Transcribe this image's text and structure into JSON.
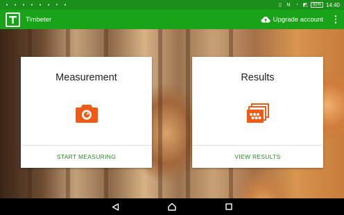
{
  "status_bar": {
    "time": "14:40",
    "battery": "92%",
    "left_icons": [
      "notification-icon",
      "notification-icon",
      "notification-icon",
      "notification-icon",
      "notification-icon",
      "notification-icon",
      "notification-icon",
      "notification-icon"
    ],
    "right_icons": [
      "vibrate-icon",
      "nfc-icon",
      "wifi-icon",
      "no-sim-icon"
    ]
  },
  "app_bar": {
    "title": "Timbeter",
    "upgrade_label": "Upgrade account"
  },
  "cards": {
    "measurement": {
      "title": "Measurement",
      "action": "START MEASURING",
      "icon": "camera-icon"
    },
    "results": {
      "title": "Results",
      "action": "VIEW RESULTS",
      "icon": "photo-gallery-icon"
    }
  },
  "colors": {
    "status_bar": "#1a8f1a",
    "app_bar": "#19a319",
    "accent_orange": "#f05a14",
    "action_green": "#1d8f1d"
  }
}
